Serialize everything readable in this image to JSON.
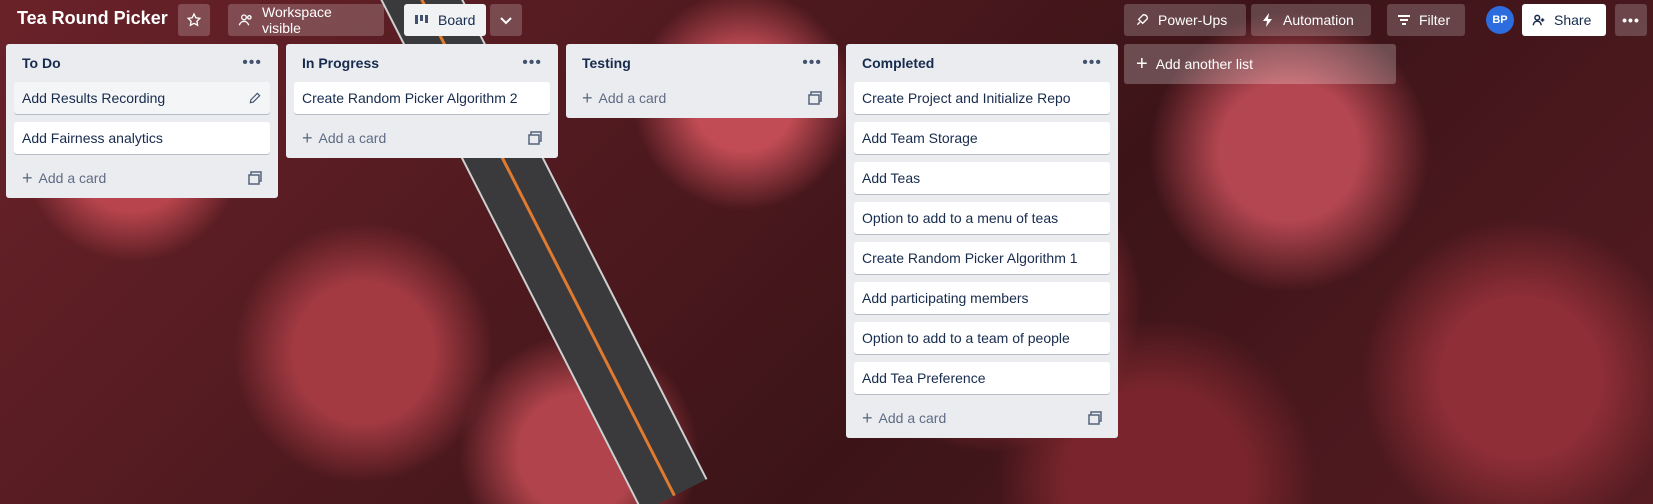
{
  "board": {
    "title": "Tea Round Picker",
    "workspace_visible": "Workspace visible",
    "view": "Board",
    "power_ups": "Power-Ups",
    "automation": "Automation",
    "filter": "Filter",
    "avatar_initials": "BP",
    "share": "Share"
  },
  "lists": [
    {
      "title": "To Do",
      "cards": [
        "Add Results Recording",
        "Add Fairness analytics"
      ],
      "add_card": "Add a card"
    },
    {
      "title": "In Progress",
      "cards": [
        "Create Random Picker Algorithm 2"
      ],
      "add_card": "Add a card"
    },
    {
      "title": "Testing",
      "cards": [],
      "add_card": "Add a card"
    },
    {
      "title": "Completed",
      "cards": [
        "Create Project and Initialize Repo",
        "Add Team Storage",
        "Add Teas",
        "Option to add to a menu of teas",
        "Create Random Picker Algorithm 1",
        "Add participating members",
        "Option to add to a team of people",
        "Add Tea Preference"
      ],
      "add_card": "Add a card"
    }
  ],
  "add_list": "Add another list",
  "colors": {
    "list_bg": "#ebecf0",
    "text": "#172b4d",
    "avatar": "#2d6cdf"
  }
}
